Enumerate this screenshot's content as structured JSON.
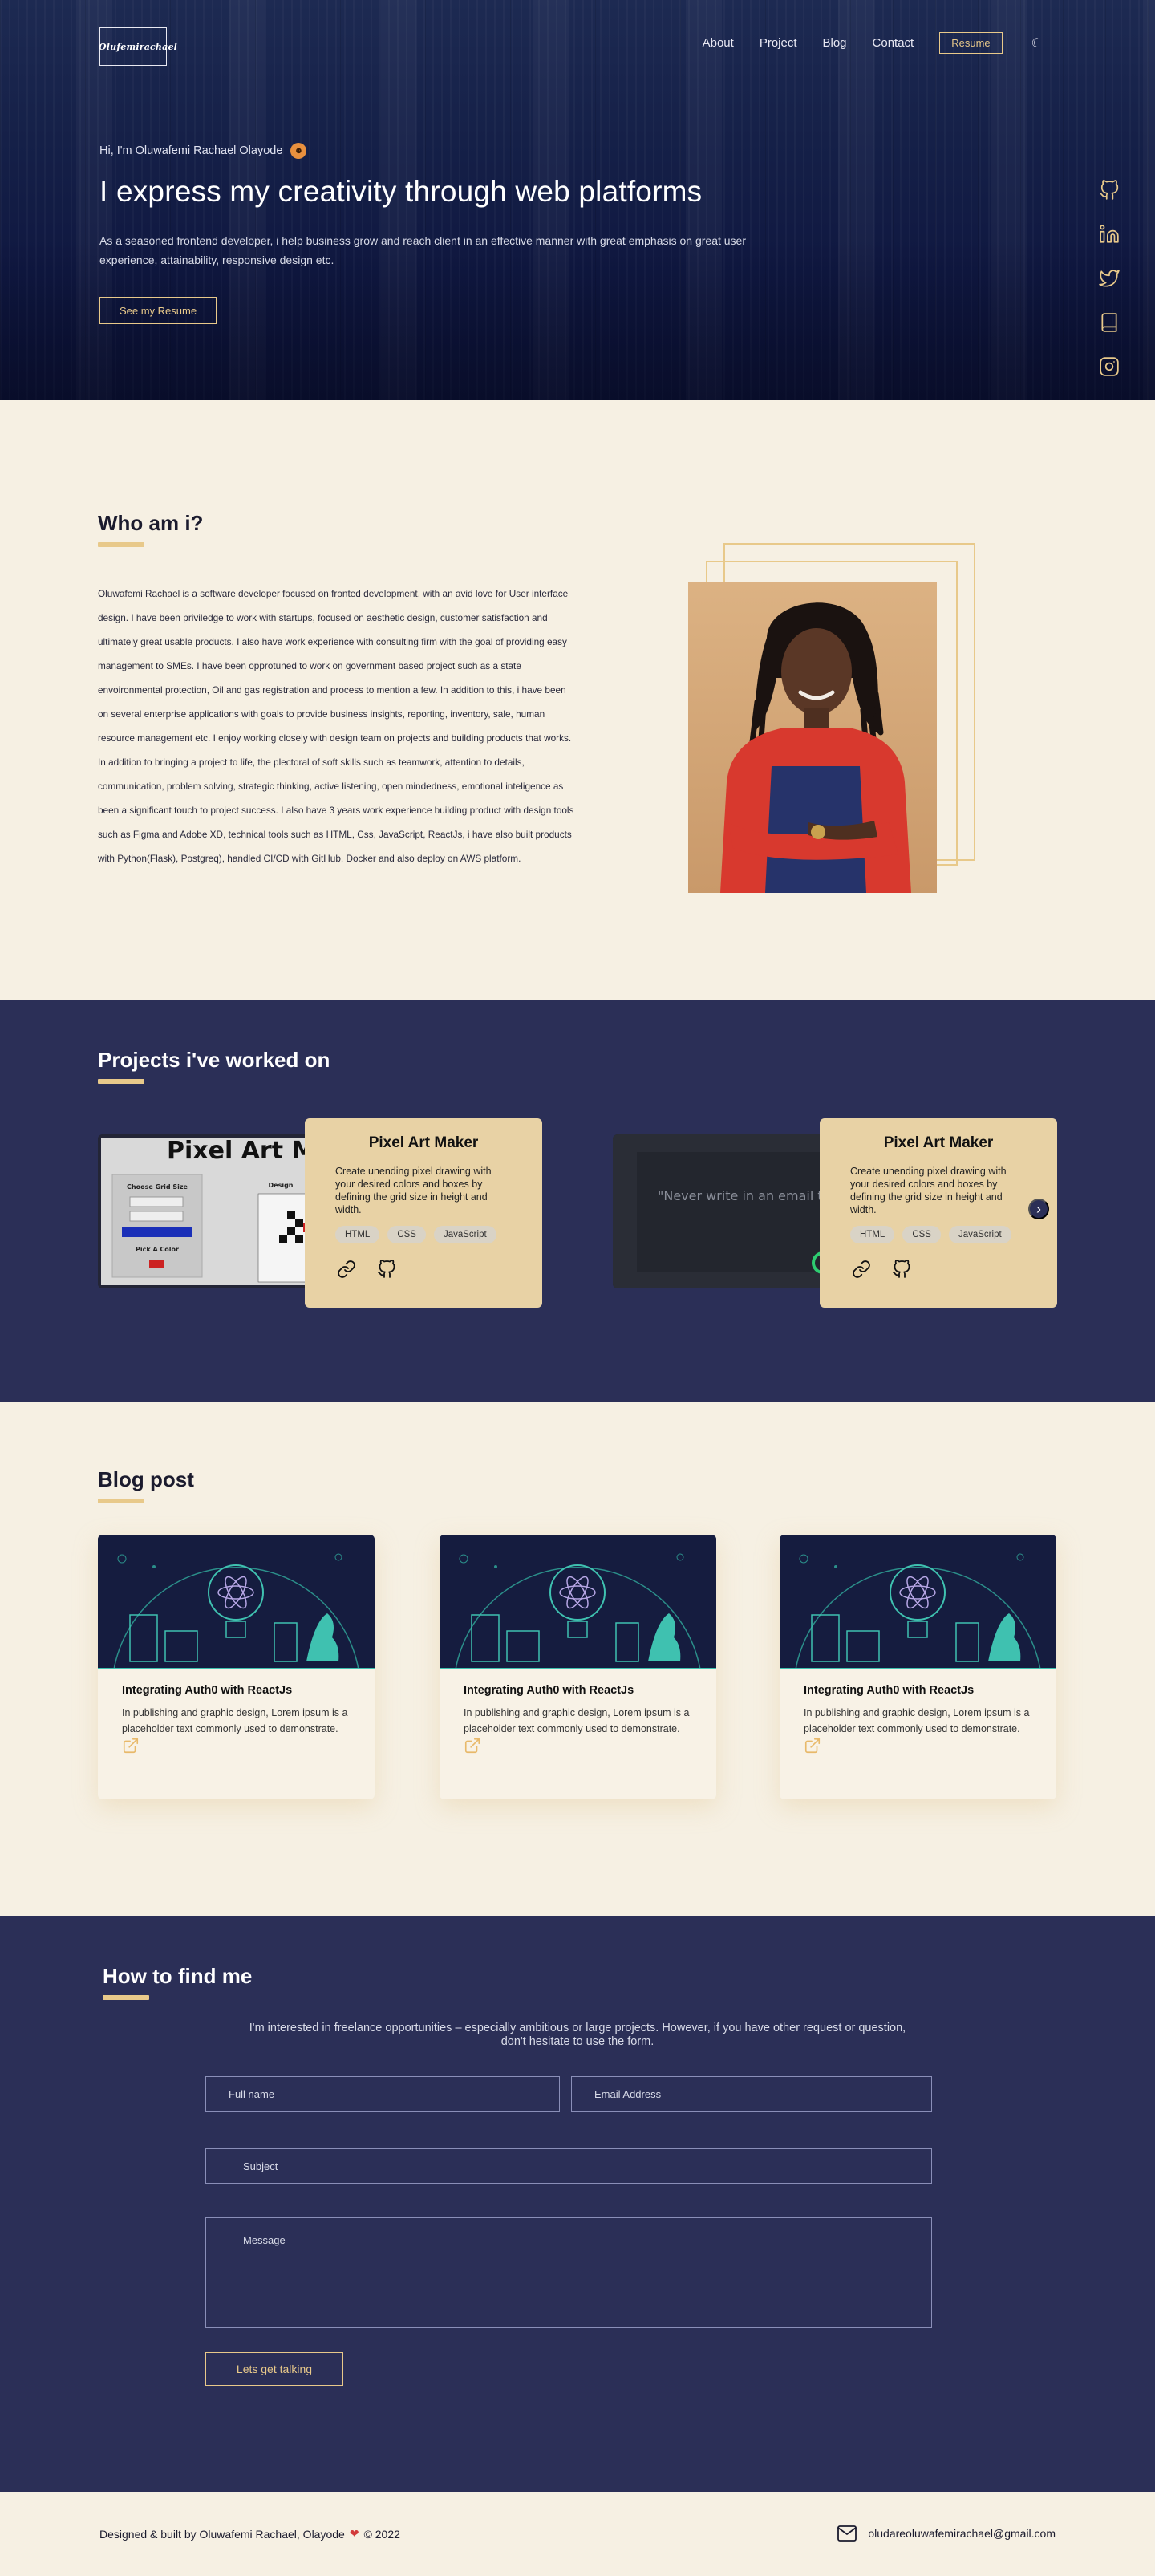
{
  "nav": {
    "logo_text": "Olufemirachael",
    "links": [
      "About",
      "Project",
      "Blog",
      "Contact"
    ],
    "resume_label": "Resume",
    "theme_icon": "moon-icon"
  },
  "hero": {
    "greeting": "Hi, I'm Oluwafemi Rachael Olayode",
    "emoji_icon": "smiling-face-icon",
    "title": "I express my creativity through web platforms",
    "description": "As a seasoned frontend developer, i help business grow and reach client in an effective manner with great emphasis on great user experience, attainability, responsive design etc.",
    "cta_label": "See my Resume",
    "socials": [
      "github-icon",
      "linkedin-icon",
      "twitter-icon",
      "book-icon",
      "instagram-icon"
    ]
  },
  "about": {
    "heading": "Who am i?",
    "paragraph_1": "Oluwafemi Rachael is a software developer focused on fronted development, with an avid love for User interface design. I have been priviledge to work with startups, focused on aesthetic design, customer satisfaction and ultimately great usable products. I also have work experience with consulting firm with the goal of providing easy management to SMEs. I have been opprotuned to work on government based project such as a state envoironmental protection, Oil and gas registration and process to mention a few. In addition to this, i have been on several enterprise applications with goals to provide business insights, reporting, inventory, sale, human resource management etc. I enjoy working closely with design team on projects and building products that works.",
    "paragraph_2": "In addition to bringing  a project to life, the plectoral of soft skills such as teamwork, attention to details, communication, problem solving, strategic thinking, active listening, open mindedness, emotional inteligence as been a significant touch to project success. I also have 3 years work experience building product with design tools such as Figma and Adobe XD, technical tools such as HTML, Css, JavaScript, ReactJs, i have also built products with Python(Flask), Postgreq), handled CI/CD with GitHub, Docker and also deploy on AWS platform."
  },
  "projects": {
    "heading": "Projects i've worked on",
    "items": [
      {
        "title": "Pixel Art Maker",
        "description": "Create unending pixel drawing with your desired colors and boxes by defining the grid size in height and width.",
        "tags": [
          "HTML",
          "CSS",
          "JavaScript"
        ],
        "screenshot_title": "Pixel Art M",
        "screenshot_labels": [
          "Choose Grid Size",
          "Pick A Color",
          "Design"
        ]
      },
      {
        "title": "Pixel Art Maker",
        "description": "Create unending pixel drawing with your desired colors and boxes by defining the grid size in height and width.",
        "tags": [
          "HTML",
          "CSS",
          "JavaScript"
        ],
        "screenshot_quote": "\"Never write in an email to someone what you wouldn't say to"
      }
    ],
    "next_icon": "chevron-right-icon"
  },
  "blog": {
    "heading": "Blog post",
    "posts": [
      {
        "title": "Integrating Auth0 with ReactJs",
        "description": "In publishing and graphic design, Lorem ipsum is a placeholder text commonly used to demonstrate."
      },
      {
        "title": "Integrating Auth0 with ReactJs",
        "description": "In publishing and graphic design, Lorem ipsum is a placeholder text commonly used to demonstrate."
      },
      {
        "title": "Integrating Auth0 with ReactJs",
        "description": "In publishing and graphic design, Lorem ipsum is a placeholder text commonly used to demonstrate."
      }
    ]
  },
  "contact": {
    "heading": "How to find me",
    "intro": "I'm interested in freelance opportunities – especially ambitious or large projects. However, if you have other request or question, don't hesitate to use the form.",
    "fullname_placeholder": "Full name",
    "email_placeholder": "Email Address",
    "subject_placeholder": "Subject",
    "message_placeholder": "Message",
    "submit_label": "Lets get talking"
  },
  "footer": {
    "credit": "Designed & built by Oluwafemi Rachael, Olayode",
    "year": "© 2022",
    "email": "oludareoluwafemirachael@gmail.com"
  },
  "colors": {
    "accent": "#e8c98a",
    "navy": "#2b2f57",
    "cream": "#f6f0e3",
    "card": "#e8d2a5"
  }
}
